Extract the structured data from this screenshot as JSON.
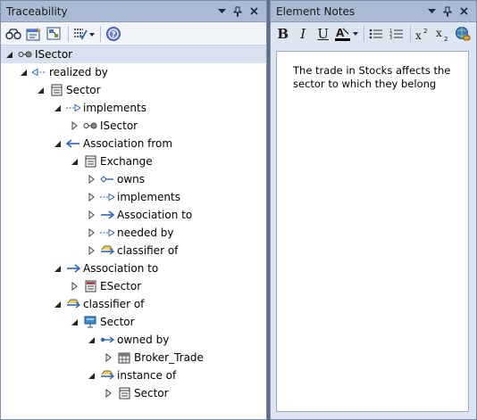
{
  "traceability": {
    "title": "Traceability",
    "tree": [
      {
        "label": "ISector",
        "icon": "interface-icon",
        "expander": "expanded"
      },
      {
        "label": "realized by",
        "icon": "realization-arrow-icon",
        "expander": "expanded"
      },
      {
        "label": "Sector",
        "icon": "class-icon",
        "expander": "expanded"
      },
      {
        "label": "implements",
        "icon": "realization-arrow-icon",
        "expander": "expanded"
      },
      {
        "label": "ISector",
        "icon": "interface-icon",
        "expander": "collapsed"
      },
      {
        "label": "Association from",
        "icon": "association-arrow-icon",
        "expander": "expanded"
      },
      {
        "label": "Exchange",
        "icon": "class-icon",
        "expander": "expanded"
      },
      {
        "label": "owns",
        "icon": "aggregation-icon",
        "expander": "collapsed"
      },
      {
        "label": "implements",
        "icon": "realization-arrow-icon",
        "expander": "collapsed"
      },
      {
        "label": "Association to",
        "icon": "association-arrow-icon",
        "expander": "collapsed"
      },
      {
        "label": "needed by",
        "icon": "realization-arrow-icon",
        "expander": "collapsed"
      },
      {
        "label": "classifier of",
        "icon": "classifier-icon",
        "expander": "collapsed"
      },
      {
        "label": "Association to",
        "icon": "association-arrow-icon",
        "expander": "expanded"
      },
      {
        "label": "ESector",
        "icon": "enum-icon",
        "expander": "collapsed"
      },
      {
        "label": "classifier of",
        "icon": "classifier-icon",
        "expander": "expanded"
      },
      {
        "label": "Sector",
        "icon": "object-icon",
        "expander": "expanded"
      },
      {
        "label": "owned by",
        "icon": "ownership-arrow-icon",
        "expander": "expanded"
      },
      {
        "label": "Broker_Trade",
        "icon": "table-icon",
        "expander": "collapsed"
      },
      {
        "label": "instance of",
        "icon": "classifier-icon",
        "expander": "expanded"
      },
      {
        "label": "Sector",
        "icon": "class-icon",
        "expander": "collapsed"
      }
    ]
  },
  "notes": {
    "title": "Element Notes",
    "bold": "B",
    "italic": "I",
    "underline": "U",
    "text": "The trade in Stocks affects the sector to which they belong"
  },
  "colors": {
    "accent_blue": "#2f64b8",
    "titlebar": "#a9bbd3",
    "frame": "#5b6f8b"
  }
}
